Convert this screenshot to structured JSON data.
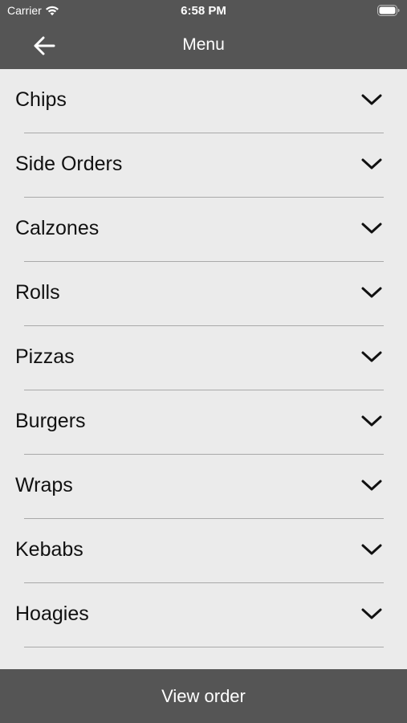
{
  "status_bar": {
    "carrier": "Carrier",
    "time": "6:58 PM"
  },
  "nav": {
    "title": "Menu",
    "back_icon": "arrow-left-icon"
  },
  "menu": {
    "items": [
      {
        "label": "Chips"
      },
      {
        "label": "Side Orders"
      },
      {
        "label": "Calzones"
      },
      {
        "label": "Rolls"
      },
      {
        "label": "Pizzas"
      },
      {
        "label": "Burgers"
      },
      {
        "label": "Wraps"
      },
      {
        "label": "Kebabs"
      },
      {
        "label": "Hoagies"
      }
    ],
    "expand_icon": "chevron-down-icon"
  },
  "footer": {
    "view_order_label": "View order"
  },
  "colors": {
    "bar": "#555555",
    "background": "#ebebeb",
    "divider": "#a9a9a9",
    "text": "#111111",
    "bar_text": "#ffffff"
  }
}
